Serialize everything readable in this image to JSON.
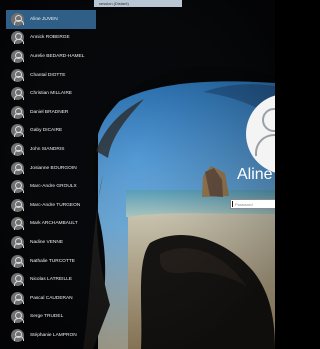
{
  "window": {
    "title_text": "session (Distant)"
  },
  "users": [
    {
      "name": "Aline JUVEN",
      "selected": true
    },
    {
      "name": "Annick ROBERGE",
      "selected": false
    },
    {
      "name": "Aurelie BEDARD-HAMEL",
      "selected": false
    },
    {
      "name": "Chantal DIOTTE",
      "selected": false
    },
    {
      "name": "Christian MILLAIRE",
      "selected": false
    },
    {
      "name": "Daniel BRADNER",
      "selected": false
    },
    {
      "name": "Gaby DICAIRE",
      "selected": false
    },
    {
      "name": "John SIANDRIS",
      "selected": false
    },
    {
      "name": "Josianne BOURGOIN",
      "selected": false
    },
    {
      "name": "Marc-Andre GROULX",
      "selected": false
    },
    {
      "name": "Marc-Andre TURGEON",
      "selected": false
    },
    {
      "name": "Mark ARCHAMBAULT",
      "selected": false
    },
    {
      "name": "Nadine VENNE",
      "selected": false
    },
    {
      "name": "Nathalie TURCOTTE",
      "selected": false
    },
    {
      "name": "Nicolas LATREILLE",
      "selected": false
    },
    {
      "name": "Pascal CAUDERAN",
      "selected": false
    },
    {
      "name": "Serge TRUDEL",
      "selected": false
    },
    {
      "name": "Stéphanie LAMPRON",
      "selected": false
    }
  ],
  "login": {
    "display_name": "Aline",
    "password_placeholder": "Password"
  },
  "colors": {
    "selected_row": "#2f5f86",
    "avatar": "#707070",
    "text": "#f1f1f1"
  },
  "icons": {
    "avatar": "user-avatar-icon",
    "big_avatar": "user-profile-icon"
  }
}
